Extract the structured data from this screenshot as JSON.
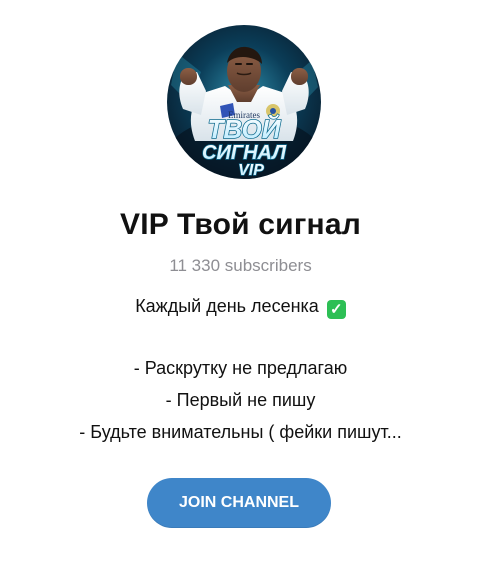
{
  "channel": {
    "title": "VIP Твой сигнал",
    "subscribers": "11 330 subscribers",
    "avatar": {
      "sponsor_text": "Emirates",
      "line1": "ТВОЙ",
      "line2": "СИГНАЛ",
      "line3": "VIP"
    },
    "description": {
      "line1": "Каждый день лесенка",
      "line2": "- Раскрутку не предлагаю",
      "line3": "- Первый не пишу",
      "line4": "- Будьте внимательны ( фейки пишут..."
    },
    "join_label": "JOIN CHANNEL"
  },
  "icons": {
    "check": "check-mark-icon"
  },
  "colors": {
    "button": "#3f86c9",
    "muted_text": "#8e8e93",
    "check": "#2dbf55"
  }
}
